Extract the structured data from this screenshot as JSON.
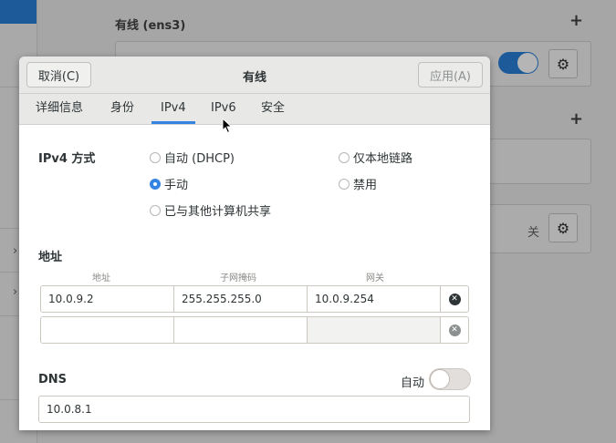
{
  "background": {
    "section1_title": "有线 (ens3)",
    "plus": "+",
    "gear": "⚙",
    "off_label": "关",
    "chevron": "›"
  },
  "dialog": {
    "title": "有线",
    "cancel": "取消(C)",
    "apply": "应用(A)",
    "tabs": [
      "详细信息",
      "身份",
      "IPv4",
      "IPv6",
      "安全"
    ],
    "active_tab": "IPv4",
    "ipv4_method_label": "IPv4 方式",
    "methods": {
      "auto": "自动 (DHCP)",
      "link_local": "仅本地链路",
      "manual": "手动",
      "disabled": "禁用",
      "shared": "已与其他计算机共享"
    },
    "selected_method": "手动",
    "address_section": "地址",
    "columns": [
      "地址",
      "子网掩码",
      "网关"
    ],
    "rows": [
      {
        "address": "10.0.9.2",
        "netmask": "255.255.255.0",
        "gateway": "10.0.9.254"
      },
      {
        "address": "",
        "netmask": "",
        "gateway": ""
      }
    ],
    "dns_label": "DNS",
    "dns_auto_label": "自动",
    "dns_auto_enabled": false,
    "dns_value": "10.0.8.1"
  },
  "colors": {
    "accent": "#3584e4",
    "selection": "#1c5a99"
  }
}
